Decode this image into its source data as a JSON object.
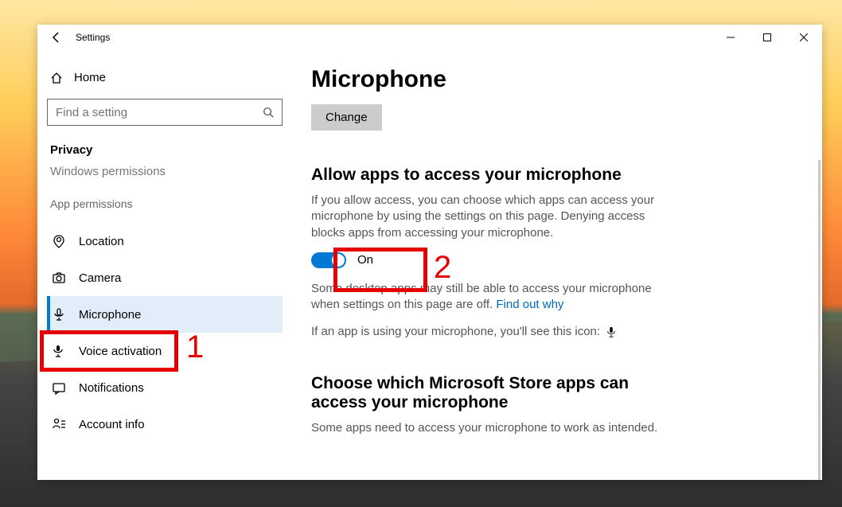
{
  "window": {
    "title": "Settings"
  },
  "sidebar": {
    "home": "Home",
    "search_placeholder": "Find a setting",
    "category": "Privacy",
    "truncated": "Windows permissions",
    "group": "App permissions",
    "items": [
      {
        "label": "Location"
      },
      {
        "label": "Camera"
      },
      {
        "label": "Microphone"
      },
      {
        "label": "Voice activation"
      },
      {
        "label": "Notifications"
      },
      {
        "label": "Account info"
      }
    ]
  },
  "content": {
    "title": "Microphone",
    "change_btn": "Change",
    "allow_heading": "Allow apps to access your microphone",
    "allow_desc": "If you allow access, you can choose which apps can access your microphone by using the settings on this page. Denying access blocks apps from accessing your microphone.",
    "toggle_state": "On",
    "desktop_note_a": "Some desktop apps may still be able to access your microphone when settings on this page are off. ",
    "find_out": "Find out why",
    "using_note": "If an app is using your microphone, you'll see this icon:",
    "choose_heading": "Choose which Microsoft Store apps can access your microphone",
    "choose_desc": "Some apps need to access your microphone to work as intended."
  },
  "annotations": {
    "one": "1",
    "two": "2"
  }
}
